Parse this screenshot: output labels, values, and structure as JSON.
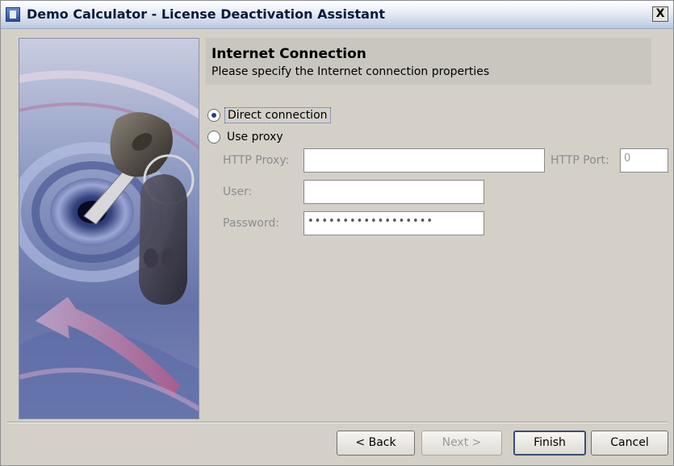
{
  "window": {
    "title": "Demo Calculator - License Deactivation Assistant",
    "close_glyph": "X"
  },
  "header": {
    "title": "Internet Connection",
    "subtitle": "Please specify the Internet connection properties"
  },
  "connection": {
    "direct_label": "Direct connection",
    "proxy_label": "Use proxy",
    "selected": "direct"
  },
  "fields": {
    "http_proxy_label": "HTTP Proxy:",
    "http_proxy_value": "",
    "http_port_label": "HTTP Port:",
    "http_port_value": "0",
    "user_label": "User:",
    "user_value": "",
    "password_label": "Password:",
    "password_value": "••••••••••••••••••"
  },
  "buttons": {
    "back": "< Back",
    "next": "Next >",
    "finish": "Finish",
    "cancel": "Cancel"
  },
  "icons": {
    "title_icon": "window-app-icon",
    "side_image": "key-in-lock-illustration"
  }
}
